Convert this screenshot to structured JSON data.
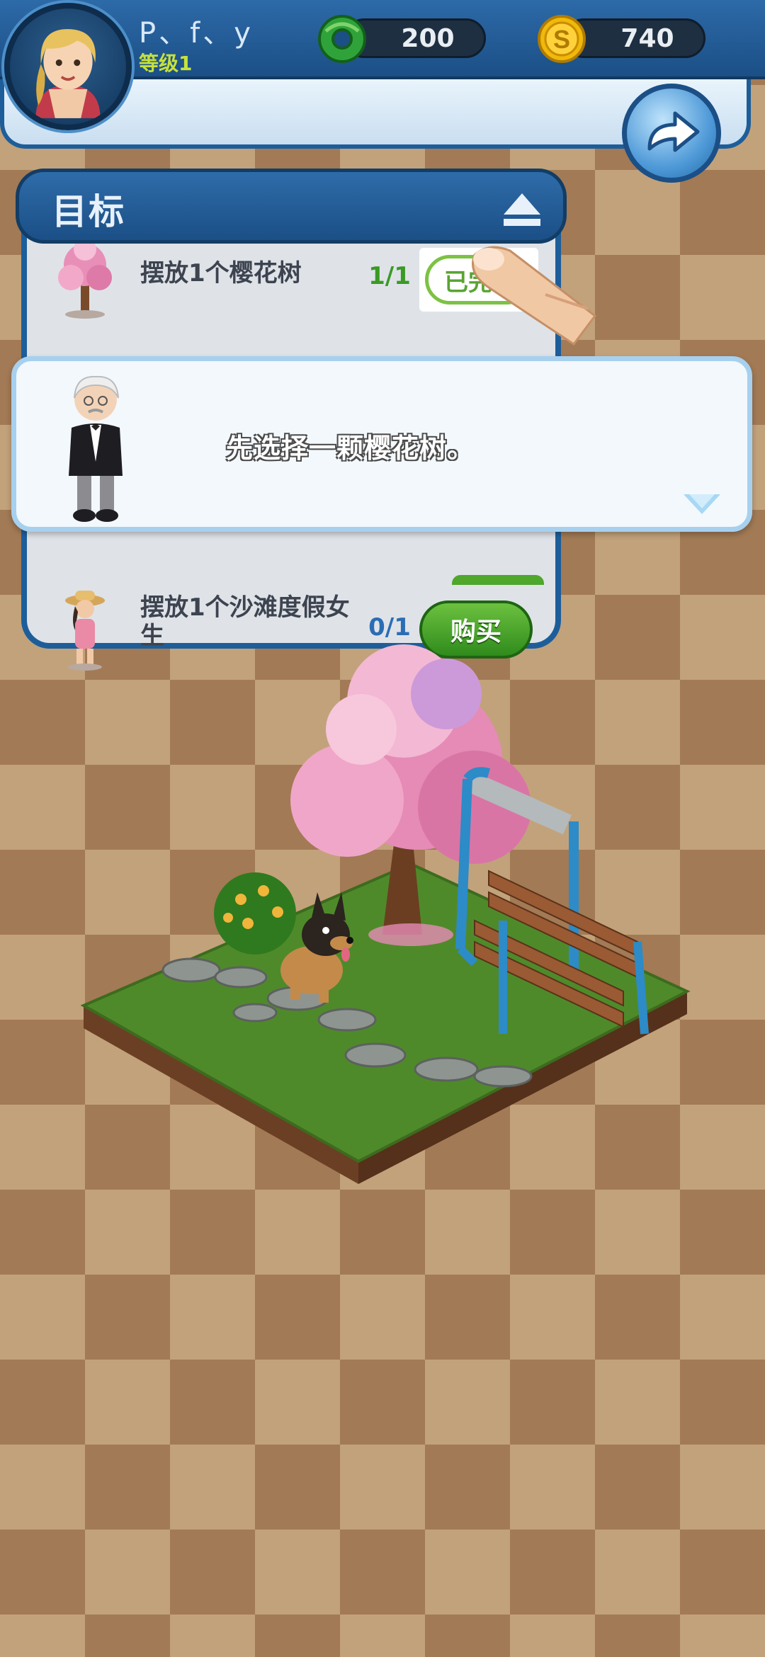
{
  "player": {
    "name": "P、f、y",
    "level": "等级1",
    "avatar_icon": "player-avatar-blonde-girl"
  },
  "currencies": {
    "jade": {
      "value": "200",
      "icon": "jade-ring-icon",
      "color": "#2fa33a"
    },
    "gold": {
      "value": "740",
      "icon": "gold-coin-icon",
      "color": "#f0b90b"
    }
  },
  "goals": {
    "title": "目标",
    "items": [
      {
        "label": "摆放1个樱花树",
        "progress": "1/1",
        "progress_color": "#3a9a24",
        "button": "已完成",
        "button_visible_text": "已完",
        "state": "done"
      },
      {
        "label": "摆放1个沙滩度假女生",
        "progress": "0/1",
        "progress_color": "#2b6db5",
        "button": "购买",
        "state": "buy"
      }
    ]
  },
  "tutorial": {
    "message": "先选择一颗樱花树。",
    "speaker_icon": "butler-character"
  },
  "colors": {
    "panel_blue": "#1d5e9a",
    "checker_light": "#c2a27b",
    "checker_dark": "#a27a55"
  }
}
